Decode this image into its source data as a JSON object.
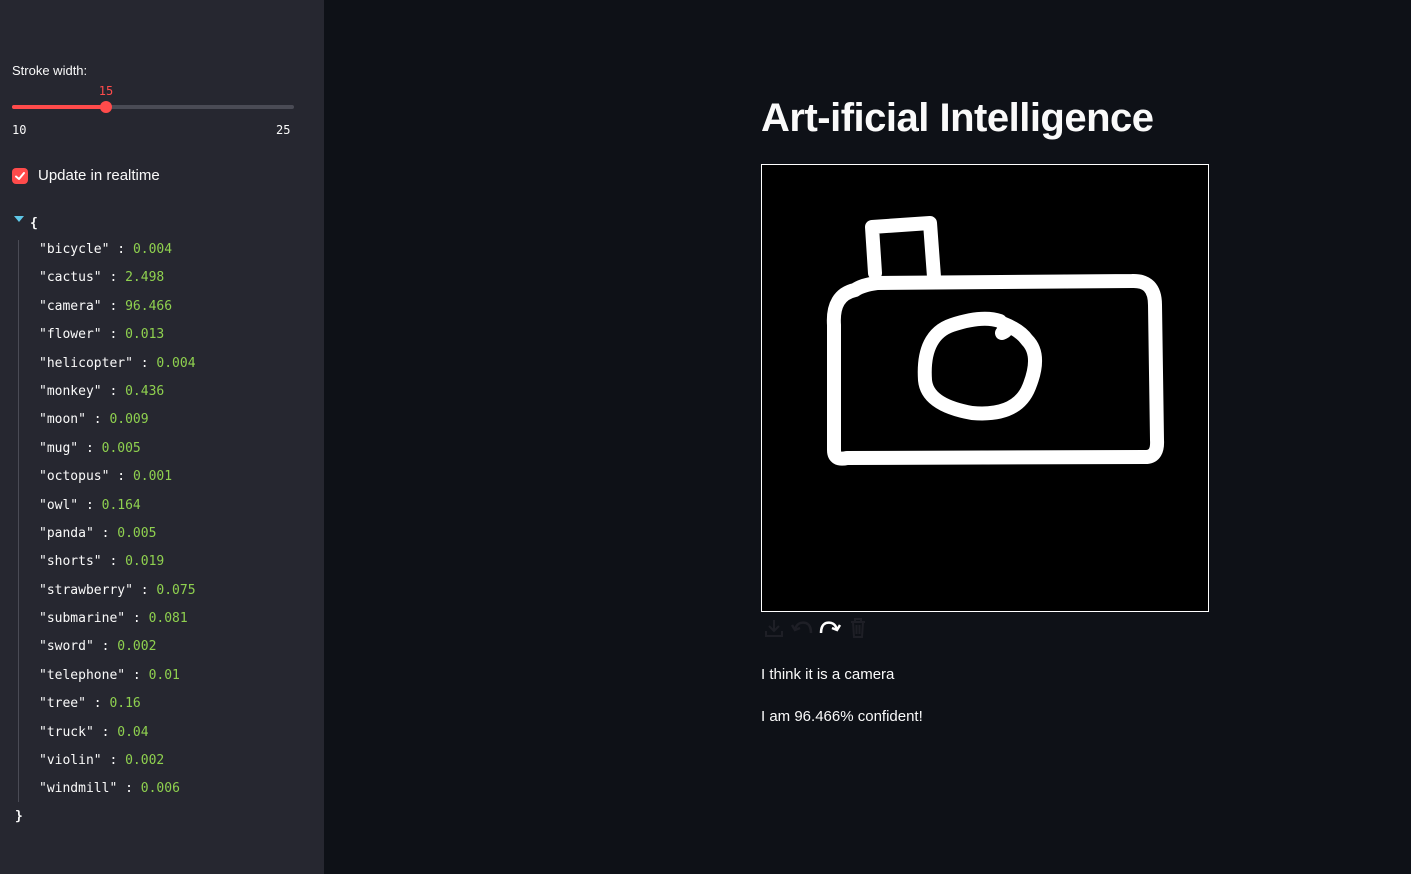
{
  "sidebar": {
    "slider": {
      "label": "Stroke width:",
      "value": "15",
      "min": "10",
      "max": "25",
      "fraction": 0.333
    },
    "checkbox": {
      "label": "Update in realtime",
      "checked": true
    },
    "json": {
      "open": "{",
      "close": "}",
      "entries": [
        {
          "key": "\"bicycle\"",
          "value": "0.004"
        },
        {
          "key": "\"cactus\"",
          "value": "2.498"
        },
        {
          "key": "\"camera\"",
          "value": "96.466"
        },
        {
          "key": "\"flower\"",
          "value": "0.013"
        },
        {
          "key": "\"helicopter\"",
          "value": "0.004"
        },
        {
          "key": "\"monkey\"",
          "value": "0.436"
        },
        {
          "key": "\"moon\"",
          "value": "0.009"
        },
        {
          "key": "\"mug\"",
          "value": "0.005"
        },
        {
          "key": "\"octopus\"",
          "value": "0.001"
        },
        {
          "key": "\"owl\"",
          "value": "0.164"
        },
        {
          "key": "\"panda\"",
          "value": "0.005"
        },
        {
          "key": "\"shorts\"",
          "value": "0.019"
        },
        {
          "key": "\"strawberry\"",
          "value": "0.075"
        },
        {
          "key": "\"submarine\"",
          "value": "0.081"
        },
        {
          "key": "\"sword\"",
          "value": "0.002"
        },
        {
          "key": "\"telephone\"",
          "value": "0.01"
        },
        {
          "key": "\"tree\"",
          "value": "0.16"
        },
        {
          "key": "\"truck\"",
          "value": "0.04"
        },
        {
          "key": "\"violin\"",
          "value": "0.002"
        },
        {
          "key": "\"windmill\"",
          "value": "0.006"
        }
      ]
    }
  },
  "main": {
    "title": "Art-ificial Intelligence",
    "prediction": "I think it is a camera",
    "confidence": "I am 96.466% confident!",
    "toolbar_icons": [
      "download-icon",
      "undo-icon",
      "redo-icon",
      "trash-icon"
    ]
  },
  "colors": {
    "accent": "#ff4b4b",
    "number": "#8fd14f",
    "sidebar_bg": "#262730",
    "main_bg": "#0e1117"
  }
}
